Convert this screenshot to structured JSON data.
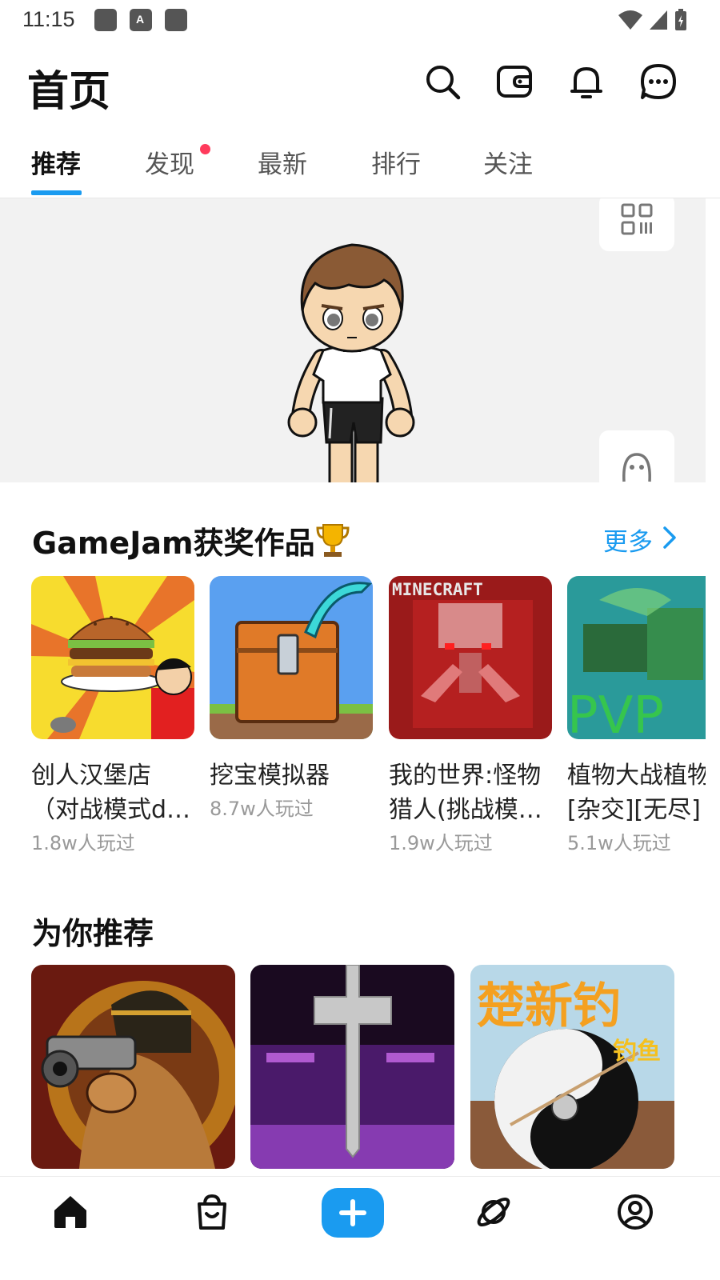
{
  "status_bar": {
    "time": "11:15",
    "notification_letter": "A"
  },
  "header": {
    "title": "首页",
    "icons": [
      "search-icon",
      "wallet-icon",
      "bell-icon",
      "chat-icon"
    ]
  },
  "tabs": [
    {
      "label": "推荐",
      "active": true
    },
    {
      "label": "发现",
      "active": false,
      "has_dot": true
    },
    {
      "label": "最新",
      "active": false
    },
    {
      "label": "排行",
      "active": false
    },
    {
      "label": "关注",
      "active": false
    }
  ],
  "banner": {
    "side_buttons": [
      "qr-code-icon",
      "avatar-face-icon"
    ]
  },
  "gamejam": {
    "title": "GameJam获奖作品",
    "more_label": "更多",
    "games": [
      {
        "name": "创人汉堡店（对战模式d…",
        "plays": "1.8w人玩过"
      },
      {
        "name": "挖宝模拟器",
        "plays": "8.7w人玩过"
      },
      {
        "name": "我的世界:怪物猎人(挑战模…",
        "plays": "1.9w人玩过"
      },
      {
        "name": "植物大战植物[杂交][无尽]",
        "plays": "5.1w人玩过"
      }
    ],
    "thumb_text": {
      "minecraft": "MINECRAFT",
      "pvp": "PVP"
    }
  },
  "recommend": {
    "title": "为你推荐",
    "thumb_text": {
      "fishing_title": "楚新钓",
      "fishing_sub": "钓鱼"
    }
  },
  "bottom_nav": [
    "home-icon",
    "store-bag-icon",
    "add-icon",
    "planet-icon",
    "profile-icon"
  ],
  "colors": {
    "accent": "#1a9bf0",
    "dot": "#ff3b5c",
    "muted": "#999999"
  }
}
